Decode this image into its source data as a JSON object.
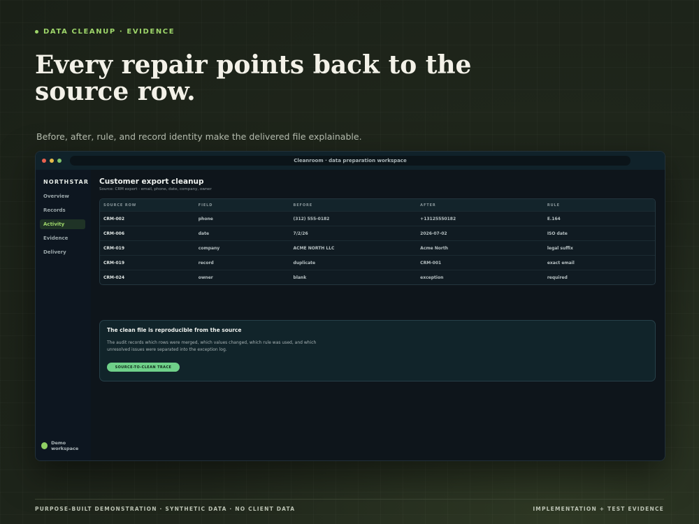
{
  "eyebrow": "DATA CLEANUP · EVIDENCE",
  "headline": "Every repair points back to the source row.",
  "subtitle": "Before, after, rule, and record identity make the delivered file explainable.",
  "window": {
    "address": "Cleanroom · data preparation workspace",
    "traffic_lights": [
      "#e8614f",
      "#e6b94a",
      "#7fc46a"
    ]
  },
  "sidebar": {
    "brand": "NORTHSTAR",
    "items": [
      {
        "label": "Overview",
        "active": false
      },
      {
        "label": "Records",
        "active": false
      },
      {
        "label": "Activity",
        "active": true
      },
      {
        "label": "Evidence",
        "active": false
      },
      {
        "label": "Delivery",
        "active": false
      }
    ],
    "workspace": "Demo workspace"
  },
  "main": {
    "title": "Customer export cleanup",
    "source": "Source: CRM export · email, phone, date, company, owner",
    "columns": [
      "SOURCE ROW",
      "FIELD",
      "BEFORE",
      "AFTER",
      "RULE"
    ],
    "rows": [
      [
        "CRM-002",
        "phone",
        "(312) 555-0182",
        "+13125550182",
        "E.164"
      ],
      [
        "CRM-006",
        "date",
        "7/2/26",
        "2026-07-02",
        "ISO date"
      ],
      [
        "CRM-019",
        "company",
        "ACME NORTH LLC",
        "Acme North",
        "legal suffix"
      ],
      [
        "CRM-019",
        "record",
        "duplicate",
        "CRM-001",
        "exact email"
      ],
      [
        "CRM-024",
        "owner",
        "blank",
        "exception",
        "required"
      ]
    ]
  },
  "callout": {
    "title": "The clean file is reproducible from the source",
    "body": "The audit records which rows were merged, which values changed, which rule was used, and which unresolved issues were separated into the exception log.",
    "button": "SOURCE-TO-CLEAN TRACE"
  },
  "footer": {
    "left": "PURPOSE-BUILT DEMONSTRATION · SYNTHETIC DATA · NO CLIENT DATA",
    "right": "IMPLEMENTATION + TEST EVIDENCE"
  },
  "colors": {
    "accent": "#9ed66a",
    "button": "#6fd089",
    "active_nav_bg": "#1f3326"
  }
}
